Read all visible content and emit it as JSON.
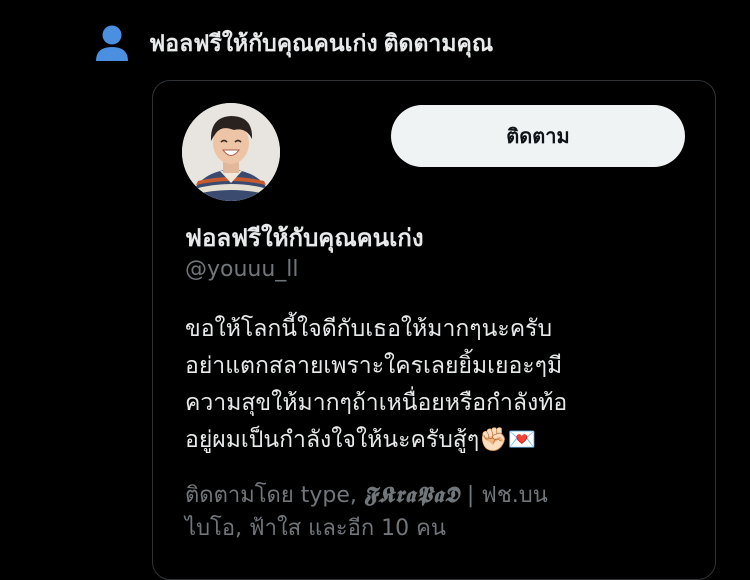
{
  "notification": {
    "icon": "user-icon",
    "account_name": "ฟอลฟรีให้กับคุณคนเก่ง",
    "action": "ติดตามคุณ",
    "icon_color": "#4a8fe0"
  },
  "profile_card": {
    "follow_button_label": "ติดตาม",
    "display_name": "ฟอลฟรีให้กับคุณคนเก่ง",
    "handle": "@youuu_ll",
    "bio_lines": [
      "ขอให้โลกนี้ใจดีกับเธอให้มากๆนะครับ",
      "อย่าแตกสลายเพราะใครเลยยิ้มเยอะๆมี",
      "ความสุขให้มากๆถ้าเหนื่อยหรือกำลังท้อ",
      "อยู่ผมเป็นกำลังใจให้นะครับสู้ๆ✊🏻💌"
    ],
    "followed_by": {
      "prefix": "ติดตามโดย type, ",
      "fancy_name": "𝕱𝕶𝖗𝖆𝕻𝖆𝕯",
      "rest_line1": " | ฟช.บน",
      "line2": "ไบโอ, ฟ้าใส และอีก 10 คน"
    }
  },
  "colors": {
    "background": "#000000",
    "text_primary": "#e7e9ea",
    "text_secondary": "#71767b",
    "card_border": "#2f3336",
    "button_bg": "#eff3f4",
    "button_text": "#0f1419"
  }
}
